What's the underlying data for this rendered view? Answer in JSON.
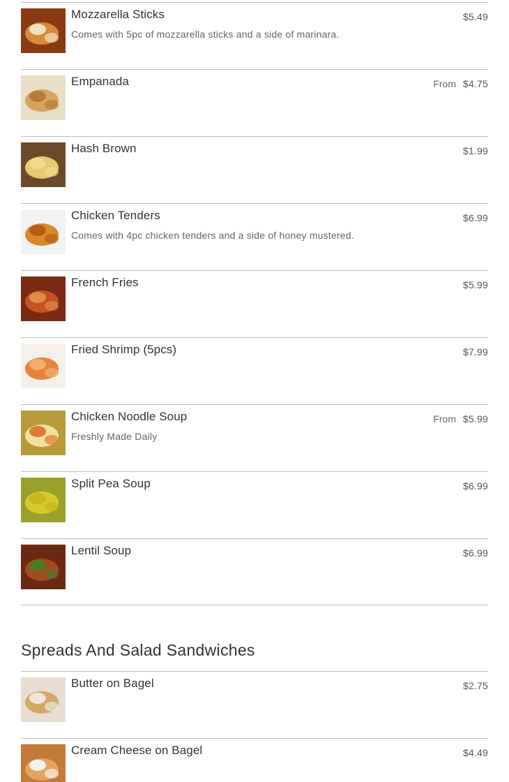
{
  "items": [
    {
      "name": "Mozzarella Sticks",
      "desc": "Comes with 5pc of mozzarella sticks and a side of marinara.",
      "from": "",
      "price": "$5.49",
      "colors": [
        "#8a3a12",
        "#d98a3a",
        "#f2e2c4"
      ]
    },
    {
      "name": "Empanada",
      "desc": "",
      "from": "From",
      "price": "$4.75",
      "colors": [
        "#e9dfc9",
        "#d8a35e",
        "#b97b38"
      ]
    },
    {
      "name": "Hash Brown",
      "desc": "",
      "from": "",
      "price": "$1.99",
      "colors": [
        "#6b4a2a",
        "#e8c870",
        "#f0d98a"
      ]
    },
    {
      "name": "Chicken Tenders",
      "desc": "Comes with 4pc chicken tenders and a side of honey mustered.",
      "from": "",
      "price": "$6.99",
      "colors": [
        "#f2f2f2",
        "#d9892a",
        "#b85e14"
      ]
    },
    {
      "name": "French Fries",
      "desc": "",
      "from": "",
      "price": "$5.99",
      "colors": [
        "#7a2a12",
        "#c4521e",
        "#e08a4a"
      ]
    },
    {
      "name": "Fried Shrimp (5pcs)",
      "desc": "",
      "from": "",
      "price": "$7.99",
      "colors": [
        "#f5f0ea",
        "#e8823a",
        "#f0b070"
      ]
    },
    {
      "name": "Chicken Noodle Soup",
      "desc": "Freshly Made Daily",
      "from": "From",
      "price": "$5.99",
      "colors": [
        "#b89a3a",
        "#f0e0a0",
        "#e07a30"
      ]
    },
    {
      "name": "Split Pea Soup",
      "desc": "",
      "from": "",
      "price": "$6.99",
      "colors": [
        "#9aa02a",
        "#d8c82a",
        "#c8b820"
      ]
    },
    {
      "name": "Lentil Soup",
      "desc": "",
      "from": "",
      "price": "$6.99",
      "colors": [
        "#6a2a12",
        "#a8481e",
        "#4a7a2a"
      ]
    }
  ],
  "section": {
    "title": "Spreads And Salad Sandwiches"
  },
  "items2": [
    {
      "name": "Butter on Bagel",
      "desc": "",
      "from": "",
      "price": "$2.75",
      "colors": [
        "#e8ddd0",
        "#d4a868",
        "#f0e6d8"
      ]
    },
    {
      "name": "Cream Cheese on Bagel",
      "desc": "",
      "from": "",
      "price": "$4.49",
      "colors": [
        "#c47a38",
        "#e2a45e",
        "#f5f2ec"
      ]
    }
  ]
}
